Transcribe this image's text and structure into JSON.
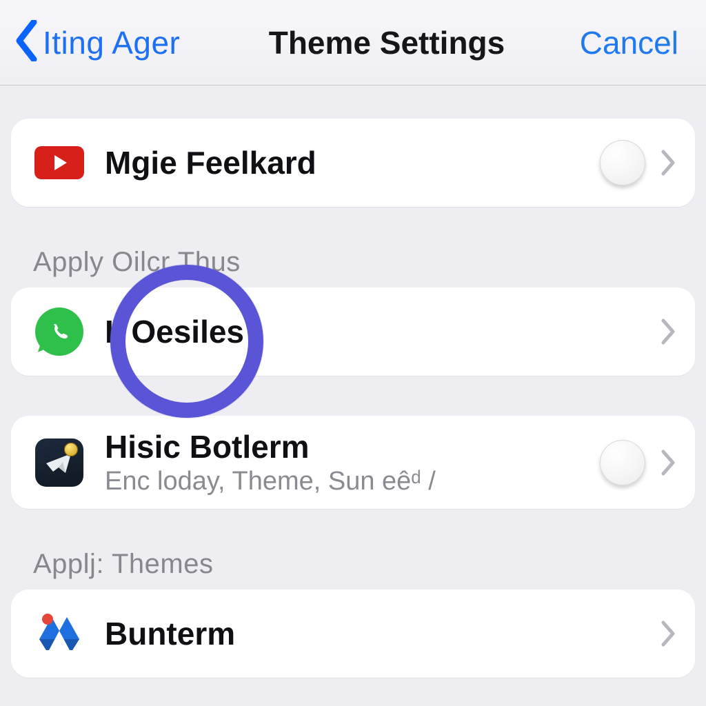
{
  "nav": {
    "back_label": "Iting Ager",
    "title": "Theme Settings",
    "cancel_label": "Cancel"
  },
  "sections": {
    "group1_header": "",
    "group2_header": "Apply Oilcr Thus",
    "group3_header": "",
    "group4_header": "Applj: Themes"
  },
  "rows": {
    "youtube": {
      "title": "Mgie Feelkard",
      "icon": "youtube-icon"
    },
    "whatsapp": {
      "title": "II  Oesiles",
      "icon": "whatsapp-icon"
    },
    "telegram": {
      "title": "Hisic Botlerm",
      "subtitle": "Enc loday, Theme, Sun eêᵈ /",
      "icon": "telegram-icon"
    },
    "drive": {
      "title": "Bunterm",
      "icon": "drive-icon"
    }
  },
  "colors": {
    "accent_blue": "#1d70f2",
    "ring": "#5a55d6",
    "youtube_red": "#d7201a",
    "whatsapp_green": "#2fbf4b"
  }
}
